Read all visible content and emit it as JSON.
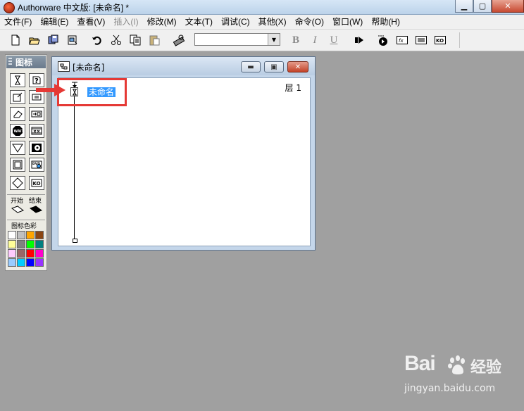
{
  "app": {
    "title": "Authorware 中文版: [未命名] *"
  },
  "menubar": {
    "items": [
      {
        "label": "文件(F)",
        "enabled": true
      },
      {
        "label": "编辑(E)",
        "enabled": true
      },
      {
        "label": "查看(V)",
        "enabled": true
      },
      {
        "label": "插入(I)",
        "enabled": false
      },
      {
        "label": "修改(M)",
        "enabled": true
      },
      {
        "label": "文本(T)",
        "enabled": true
      },
      {
        "label": "调试(C)",
        "enabled": true
      },
      {
        "label": "其他(X)",
        "enabled": true
      },
      {
        "label": "命令(O)",
        "enabled": true
      },
      {
        "label": "窗口(W)",
        "enabled": true
      },
      {
        "label": "帮助(H)",
        "enabled": true
      }
    ]
  },
  "toolbar": {
    "font_value": "",
    "bold_label": "B",
    "italic_label": "I",
    "underline_label": "U",
    "icons": [
      "new-file-icon",
      "open-file-icon",
      "save-all-icon",
      "import-icon",
      "undo-icon",
      "cut-icon",
      "copy-icon",
      "paste-icon",
      "find-icon",
      "run-icon",
      "control-panel-icon",
      "functions-icon",
      "variables-icon",
      "knowledge-objects-icon"
    ]
  },
  "palette": {
    "title": "图标",
    "icons": [
      "display-icon",
      "interaction-icon",
      "motion-icon",
      "calculation-icon",
      "erase-icon",
      "navigate-icon",
      "wait-icon",
      "movie-icon",
      "decision-icon",
      "sound-icon",
      "framework-icon",
      "dvd-icon",
      "map-icon",
      "ko-icon"
    ],
    "start_label": "开始",
    "end_label": "结束",
    "color_label": "图标色彩",
    "colors": [
      "#ffffff",
      "#c0c0c0",
      "#ffa500",
      "#8b4513",
      "#ffff99",
      "#808080",
      "#00ff00",
      "#008080",
      "#ffccff",
      "#996666",
      "#ff0000",
      "#ff00cc",
      "#99ccff",
      "#00ccff",
      "#0000ff",
      "#9933ff"
    ]
  },
  "design_window": {
    "title": "[未命名]",
    "layer_label": "层 1",
    "flow_icon_label": "未命名"
  },
  "watermark": {
    "brand": "Bai",
    "sub": "经验",
    "url": "jingyan.baidu.com"
  }
}
